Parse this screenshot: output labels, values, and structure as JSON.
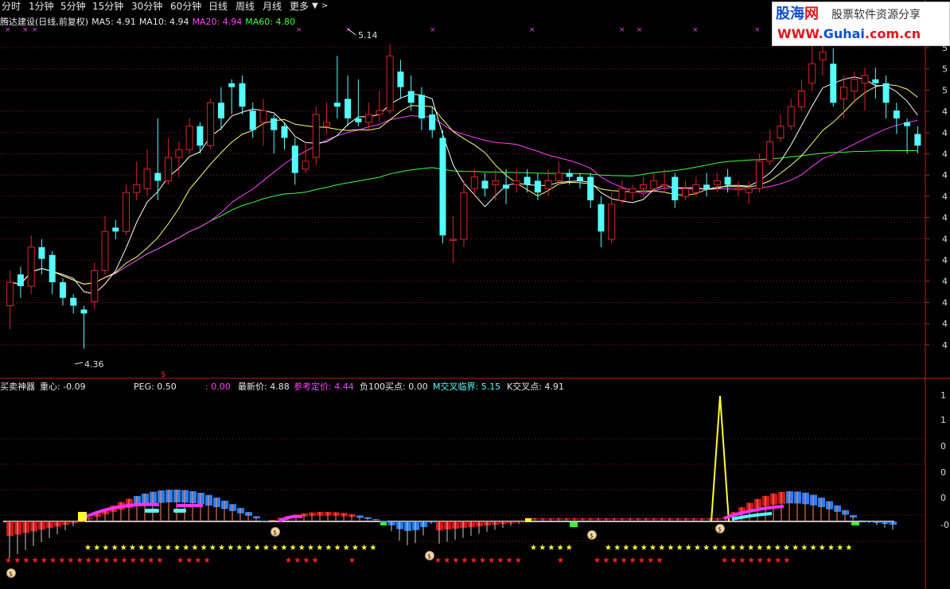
{
  "tabs": [
    "分时",
    "1分钟",
    "5分钟",
    "15分钟",
    "30分钟",
    "60分钟",
    "日线",
    "周线",
    "月线",
    "更多"
  ],
  "active_tab": "分时",
  "legend": {
    "title": "腾达建设(日线,前复权)",
    "ma5": "MA5: 4.91",
    "ma10": "MA10: 4.94",
    "ma20": "MA20: 4.94",
    "ma60": "MA60: 4.80"
  },
  "annotations": {
    "high": "5.14",
    "low": "4.36"
  },
  "indicator_legend": {
    "name": "买卖神器",
    "center": "重心: -0.09",
    "peg": "PEG: 0.50",
    "blank": ": 0.00",
    "latest": "最新价: 4.88",
    "ref_price": "参考定价: 4.44",
    "neg100": "负100买点: 0.00",
    "m_cross": "M交叉临界: 5.15",
    "k_cross": "K交叉点: 4.91"
  },
  "right_axis_main": [
    "5",
    "5",
    "5",
    "4",
    "4",
    "4",
    "4",
    "4",
    "4",
    "4",
    "4",
    "4",
    "4",
    "4",
    "4"
  ],
  "right_axis_ind": [
    "1",
    "1",
    "0",
    "0",
    "0",
    "-0"
  ],
  "watermark": {
    "brand_blue": "股海",
    "brand_red": "网",
    "slogan": "股票软件资源分享",
    "url_red": "WWW.",
    "url_blue": "Guhai",
    "url_red2": ".com.cn"
  },
  "colors": {
    "up": "#e0242a",
    "down": "#54ffff",
    "ma5": "#ffffff",
    "ma10": "#ffff70",
    "ma20": "#ff40ff",
    "ma60": "#40ff40",
    "grid": "#8b1a1a",
    "active_tab": "#33a6ff"
  },
  "chart_data": {
    "type": "candlestick",
    "series": [
      {
        "name": "MA5",
        "value": 4.91
      },
      {
        "name": "MA10",
        "value": 4.94
      },
      {
        "name": "MA20",
        "value": 4.94
      },
      {
        "name": "MA60",
        "value": 4.8
      }
    ],
    "high": 5.14,
    "low": 4.36,
    "candles": [
      {
        "o": 4.47,
        "c": 4.53,
        "h": 4.56,
        "l": 4.41
      },
      {
        "o": 4.55,
        "c": 4.52,
        "h": 4.57,
        "l": 4.49
      },
      {
        "o": 4.52,
        "c": 4.62,
        "h": 4.65,
        "l": 4.5
      },
      {
        "o": 4.62,
        "c": 4.59,
        "h": 4.64,
        "l": 4.55
      },
      {
        "o": 4.6,
        "c": 4.53,
        "h": 4.61,
        "l": 4.5
      },
      {
        "o": 4.53,
        "c": 4.49,
        "h": 4.54,
        "l": 4.47
      },
      {
        "o": 4.49,
        "c": 4.47,
        "h": 4.5,
        "l": 4.45
      },
      {
        "o": 4.46,
        "c": 4.45,
        "h": 4.47,
        "l": 4.36
      },
      {
        "o": 4.48,
        "c": 4.56,
        "h": 4.58,
        "l": 4.46
      },
      {
        "o": 4.56,
        "c": 4.66,
        "h": 4.7,
        "l": 4.55
      },
      {
        "o": 4.67,
        "c": 4.66,
        "h": 4.69,
        "l": 4.64
      },
      {
        "o": 4.66,
        "c": 4.76,
        "h": 4.78,
        "l": 4.65
      },
      {
        "o": 4.76,
        "c": 4.78,
        "h": 4.84,
        "l": 4.74
      },
      {
        "o": 4.77,
        "c": 4.82,
        "h": 4.87,
        "l": 4.75
      },
      {
        "o": 4.81,
        "c": 4.79,
        "h": 4.95,
        "l": 4.74
      },
      {
        "o": 4.79,
        "c": 4.85,
        "h": 4.9,
        "l": 4.78
      },
      {
        "o": 4.85,
        "c": 4.87,
        "h": 4.89,
        "l": 4.8
      },
      {
        "o": 4.87,
        "c": 4.93,
        "h": 4.95,
        "l": 4.86
      },
      {
        "o": 4.93,
        "c": 4.88,
        "h": 4.94,
        "l": 4.86
      },
      {
        "o": 4.88,
        "c": 4.99,
        "h": 5.0,
        "l": 4.87
      },
      {
        "o": 4.99,
        "c": 4.95,
        "h": 5.03,
        "l": 4.92
      },
      {
        "o": 5.04,
        "c": 5.03,
        "h": 5.05,
        "l": 4.96
      },
      {
        "o": 5.04,
        "c": 4.98,
        "h": 5.06,
        "l": 4.96
      },
      {
        "o": 4.97,
        "c": 4.92,
        "h": 4.99,
        "l": 4.9
      },
      {
        "o": 4.94,
        "c": 4.97,
        "h": 5.0,
        "l": 4.88
      },
      {
        "o": 4.95,
        "c": 4.92,
        "h": 4.96,
        "l": 4.86
      },
      {
        "o": 4.93,
        "c": 4.9,
        "h": 4.94,
        "l": 4.87
      },
      {
        "o": 4.88,
        "c": 4.81,
        "h": 4.9,
        "l": 4.78
      },
      {
        "o": 4.82,
        "c": 4.84,
        "h": 4.89,
        "l": 4.81
      },
      {
        "o": 4.85,
        "c": 4.96,
        "h": 4.98,
        "l": 4.83
      },
      {
        "o": 4.93,
        "c": 4.94,
        "h": 4.99,
        "l": 4.91
      },
      {
        "o": 4.99,
        "c": 4.98,
        "h": 5.11,
        "l": 4.95
      },
      {
        "o": 5.0,
        "c": 4.95,
        "h": 5.06,
        "l": 4.93
      },
      {
        "o": 4.95,
        "c": 4.94,
        "h": 5.05,
        "l": 4.93
      },
      {
        "o": 4.94,
        "c": 4.96,
        "h": 4.99,
        "l": 4.92
      },
      {
        "o": 4.96,
        "c": 4.97,
        "h": 5.02,
        "l": 4.94
      },
      {
        "o": 4.97,
        "c": 5.11,
        "h": 5.14,
        "l": 4.96
      },
      {
        "o": 5.07,
        "c": 5.03,
        "h": 5.1,
        "l": 5.0
      },
      {
        "o": 5.02,
        "c": 4.99,
        "h": 5.06,
        "l": 4.97
      },
      {
        "o": 5.01,
        "c": 4.95,
        "h": 5.03,
        "l": 4.92
      },
      {
        "o": 4.96,
        "c": 4.92,
        "h": 4.98,
        "l": 4.9
      },
      {
        "o": 4.9,
        "c": 4.65,
        "h": 4.92,
        "l": 4.63
      },
      {
        "o": 4.64,
        "c": 4.64,
        "h": 4.7,
        "l": 4.58
      },
      {
        "o": 4.64,
        "c": 4.76,
        "h": 4.79,
        "l": 4.62
      },
      {
        "o": 4.77,
        "c": 4.8,
        "h": 4.82,
        "l": 4.75
      },
      {
        "o": 4.79,
        "c": 4.77,
        "h": 4.81,
        "l": 4.75
      },
      {
        "o": 4.78,
        "c": 4.79,
        "h": 4.82,
        "l": 4.74
      },
      {
        "o": 4.78,
        "c": 4.77,
        "h": 4.82,
        "l": 4.73
      },
      {
        "o": 4.78,
        "c": 4.79,
        "h": 4.82,
        "l": 4.76
      },
      {
        "o": 4.8,
        "c": 4.78,
        "h": 4.82,
        "l": 4.76
      },
      {
        "o": 4.79,
        "c": 4.76,
        "h": 4.81,
        "l": 4.74
      },
      {
        "o": 4.77,
        "c": 4.79,
        "h": 4.82,
        "l": 4.75
      },
      {
        "o": 4.79,
        "c": 4.81,
        "h": 4.84,
        "l": 4.78
      },
      {
        "o": 4.81,
        "c": 4.8,
        "h": 4.82,
        "l": 4.78
      },
      {
        "o": 4.8,
        "c": 4.79,
        "h": 4.81,
        "l": 4.77
      },
      {
        "o": 4.8,
        "c": 4.74,
        "h": 4.81,
        "l": 4.72
      },
      {
        "o": 4.73,
        "c": 4.66,
        "h": 4.75,
        "l": 4.62
      },
      {
        "o": 4.64,
        "c": 4.73,
        "h": 4.76,
        "l": 4.63
      },
      {
        "o": 4.74,
        "c": 4.77,
        "h": 4.79,
        "l": 4.73
      },
      {
        "o": 4.76,
        "c": 4.77,
        "h": 4.78,
        "l": 4.74
      },
      {
        "o": 4.77,
        "c": 4.78,
        "h": 4.8,
        "l": 4.75
      },
      {
        "o": 4.77,
        "c": 4.79,
        "h": 4.81,
        "l": 4.76
      },
      {
        "o": 4.78,
        "c": 4.78,
        "h": 4.82,
        "l": 4.76
      },
      {
        "o": 4.8,
        "c": 4.74,
        "h": 4.81,
        "l": 4.72
      },
      {
        "o": 4.75,
        "c": 4.77,
        "h": 4.79,
        "l": 4.74
      },
      {
        "o": 4.76,
        "c": 4.78,
        "h": 4.8,
        "l": 4.75
      },
      {
        "o": 4.78,
        "c": 4.77,
        "h": 4.81,
        "l": 4.75
      },
      {
        "o": 4.78,
        "c": 4.79,
        "h": 4.81,
        "l": 4.76
      },
      {
        "o": 4.8,
        "c": 4.78,
        "h": 4.82,
        "l": 4.76
      },
      {
        "o": 4.77,
        "c": 4.77,
        "h": 4.79,
        "l": 4.75
      },
      {
        "o": 4.76,
        "c": 4.77,
        "h": 4.79,
        "l": 4.73
      },
      {
        "o": 4.77,
        "c": 4.84,
        "h": 4.86,
        "l": 4.76
      },
      {
        "o": 4.84,
        "c": 4.89,
        "h": 4.92,
        "l": 4.83
      },
      {
        "o": 4.9,
        "c": 4.93,
        "h": 4.96,
        "l": 4.89
      },
      {
        "o": 4.93,
        "c": 4.98,
        "h": 5.0,
        "l": 4.92
      },
      {
        "o": 4.98,
        "c": 5.02,
        "h": 5.05,
        "l": 4.97
      },
      {
        "o": 5.04,
        "c": 5.09,
        "h": 5.14,
        "l": 5.02
      },
      {
        "o": 5.1,
        "c": 5.12,
        "h": 5.14,
        "l": 5.06
      },
      {
        "o": 5.09,
        "c": 4.99,
        "h": 5.13,
        "l": 4.98
      },
      {
        "o": 5.0,
        "c": 5.03,
        "h": 5.06,
        "l": 4.95
      },
      {
        "o": 5.02,
        "c": 5.05,
        "h": 5.07,
        "l": 4.99
      },
      {
        "o": 5.04,
        "c": 5.06,
        "h": 5.08,
        "l": 4.97
      },
      {
        "o": 5.05,
        "c": 5.04,
        "h": 5.08,
        "l": 5.0
      },
      {
        "o": 5.04,
        "c": 4.99,
        "h": 5.06,
        "l": 4.95
      },
      {
        "o": 4.97,
        "c": 4.95,
        "h": 4.99,
        "l": 4.91
      },
      {
        "o": 4.94,
        "c": 4.93,
        "h": 4.95,
        "l": 4.86
      },
      {
        "o": 4.91,
        "c": 4.88,
        "h": 4.93,
        "l": 4.86
      }
    ],
    "indicator": {
      "name": "买卖神器",
      "center": -0.09,
      "peg": 0.5,
      "latest": 4.88,
      "ref_price": 4.44,
      "neg100_buy": 0.0,
      "m_cross_threshold": 5.15,
      "k_cross": 4.91
    }
  }
}
